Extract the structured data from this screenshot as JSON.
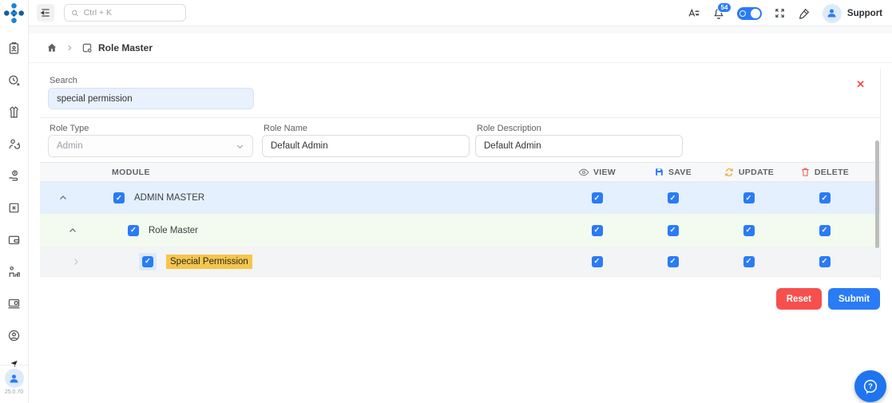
{
  "header": {
    "search_placeholder": "Ctrl + K",
    "notifications": "54",
    "user": "Support"
  },
  "sidebar": {
    "version": "25.0.70",
    "icons": [
      "id-badge",
      "clock-plus",
      "vest",
      "user-sync",
      "hand-coin",
      "box-close",
      "wallet",
      "leaderboard",
      "devices",
      "user-support"
    ]
  },
  "breadcrumb": {
    "current": "Role Master"
  },
  "panel": {
    "search": {
      "label": "Search",
      "value": "special permission"
    },
    "role_type": {
      "label": "Role Type",
      "value": "Admin"
    },
    "role_name": {
      "label": "Role Name",
      "value": "Default Admin"
    },
    "role_description": {
      "label": "Role Description",
      "value": "Default Admin"
    }
  },
  "table": {
    "module_header": "MODULE",
    "columns": [
      {
        "label": "VIEW",
        "icon": "eye-icon"
      },
      {
        "label": "SAVE",
        "icon": "save-icon"
      },
      {
        "label": "UPDATE",
        "icon": "sync-icon"
      },
      {
        "label": "DELETE",
        "icon": "trash-icon"
      }
    ],
    "rows": [
      {
        "label": "ADMIN MASTER",
        "level": 0,
        "expanded": true,
        "checked": true,
        "permissions": {
          "view": true,
          "save": true,
          "update": true,
          "delete": true
        }
      },
      {
        "label": "Role Master",
        "level": 1,
        "expanded": true,
        "checked": true,
        "permissions": {
          "view": true,
          "save": true,
          "update": true,
          "delete": true
        }
      },
      {
        "label": "Special Permission",
        "level": 2,
        "expanded": false,
        "checked": true,
        "highlighted": true,
        "permissions": {
          "view": true,
          "save": true,
          "update": true,
          "delete": true
        }
      }
    ]
  },
  "buttons": {
    "reset": "Reset",
    "submit": "Submit"
  },
  "icons": {
    "close": "✕",
    "help": "?"
  },
  "colors": {
    "accent": "#2a7bf6",
    "danger": "#f5504e",
    "highlight": "#f6c64b",
    "row_admin_bg": "#e4f0fd",
    "row_role_bg": "#f3faef",
    "row_special_bg": "#f3f4f5",
    "search_bg": "#e9f1fd",
    "badge": "#2a7bf6"
  }
}
